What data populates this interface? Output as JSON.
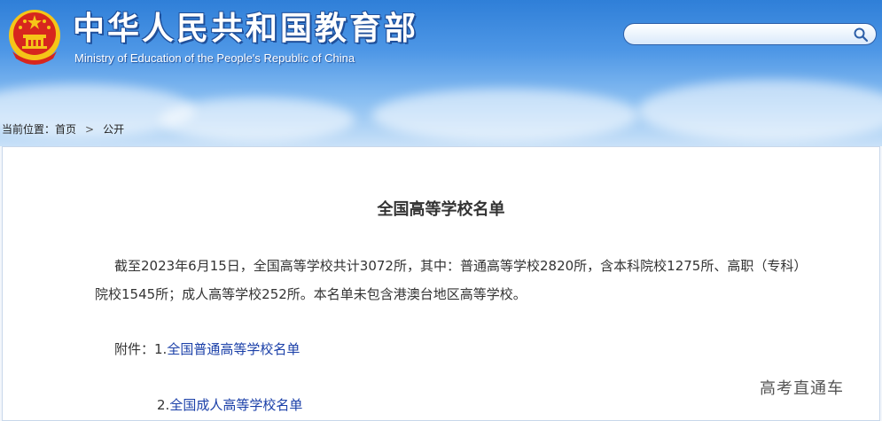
{
  "header": {
    "title_cn": "中华人民共和国教育部",
    "title_en": "Ministry of Education of the People's Republic of China",
    "search": {
      "placeholder": ""
    }
  },
  "breadcrumb": {
    "prefix": "当前位置：",
    "items": [
      "首页",
      "公开"
    ],
    "separator": ">"
  },
  "article": {
    "title": "全国高等学校名单",
    "paragraph": "截至2023年6月15日，全国高等学校共计3072所，其中：普通高等学校2820所，含本科院校1275所、高职（专科）院校1545所；成人高等学校252所。本名单未包含港澳台地区高等学校。",
    "attachments_label": "附件：",
    "attachments": [
      {
        "index": "1.",
        "label": "全国普通高等学校名单"
      },
      {
        "index": "2.",
        "label": "全国成人高等学校名单"
      }
    ]
  },
  "watermark": "高考直通车",
  "colors": {
    "header_top": "#2f7fd8",
    "link": "#1a3fa8",
    "text": "#333333",
    "emblem_red": "#d7261e",
    "emblem_gold": "#f5c518"
  },
  "icons": {
    "search": "search-icon",
    "emblem": "national-emblem-icon"
  }
}
